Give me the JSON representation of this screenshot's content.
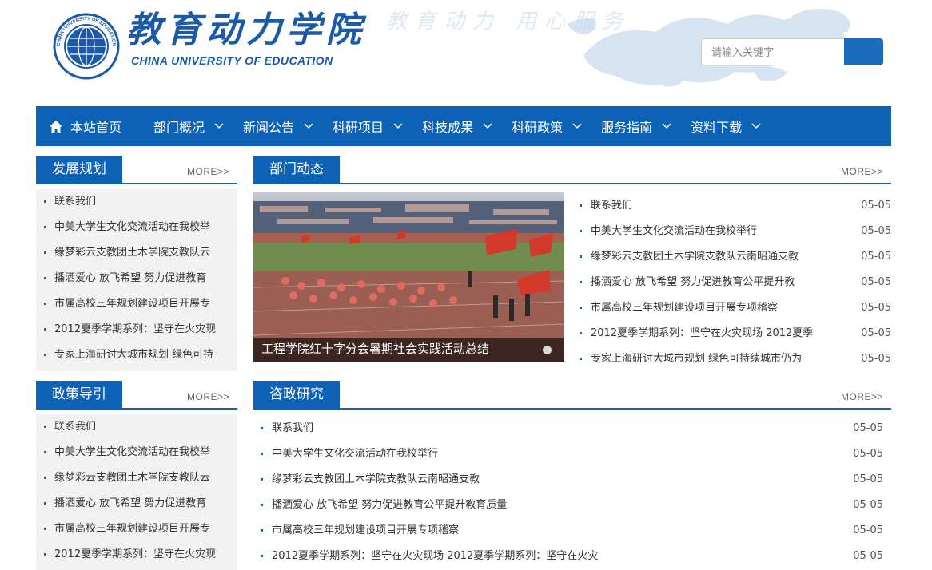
{
  "header": {
    "logo_title": "教育动力学院",
    "logo_subtitle": "CHINA UNIVERSITY OF EDUCATION",
    "logo_seal_text": "CHINA UNIVERSITY OF EDUCATION",
    "watermark": "教育动力 用心服务",
    "search": {
      "placeholder": "请输入关键字",
      "value": ""
    }
  },
  "nav": {
    "home": "本站首页",
    "items": [
      "部门概况",
      "新闻公告",
      "科研项目",
      "科技成果",
      "科研政策",
      "服务指南",
      "资料下载"
    ]
  },
  "more_label": "MORE>>",
  "panels": {
    "development": {
      "title": "发展规划",
      "items": [
        "联系我们",
        "中美大学生文化交流活动在我校举",
        "缘梦彩云支教团土木学院支教队云",
        "播洒爱心 放飞希望 努力促进教育",
        "市属高校三年规划建设项目开展专",
        "2012夏季学期系列：坚守在火灾现",
        "专家上海研讨大城市规划 绿色可持"
      ]
    },
    "policy": {
      "title": "政策导引",
      "items": [
        "联系我们",
        "中美大学生文化交流活动在我校举",
        "缘梦彩云支教团土木学院支教队云",
        "播洒爱心 放飞希望 努力促进教育",
        "市属高校三年规划建设项目开展专",
        "2012夏季学期系列：坚守在火灾现"
      ]
    },
    "dept_news": {
      "title": "部门动态",
      "photo_caption": "工程学院红十字分会暑期社会实践活动总结",
      "items": [
        {
          "text": "联系我们",
          "date": "05-05"
        },
        {
          "text": "中美大学生文化交流活动在我校举行",
          "date": "05-05"
        },
        {
          "text": "缘梦彩云支教团土木学院支教队云南昭通支教",
          "date": "05-05"
        },
        {
          "text": "播洒爱心 放飞希望 努力促进教育公平提升教",
          "date": "05-05"
        },
        {
          "text": "市属高校三年规划建设项目开展专项稽察",
          "date": "05-05"
        },
        {
          "text": "2012夏季学期系列：坚守在火灾现场 2012夏季",
          "date": "05-05"
        },
        {
          "text": "专家上海研讨大城市规划 绿色可持续城市仍为",
          "date": "05-05"
        }
      ]
    },
    "consult": {
      "title": "咨政研究",
      "items": [
        {
          "text": "联系我们",
          "date": "05-05"
        },
        {
          "text": "中美大学生文化交流活动在我校举行",
          "date": "05-05"
        },
        {
          "text": "缘梦彩云支教团土木学院支教队云南昭通支教",
          "date": "05-05"
        },
        {
          "text": "播洒爱心 放飞希望 努力促进教育公平提升教育质量",
          "date": "05-05"
        },
        {
          "text": "市属高校三年规划建设项目开展专项稽察",
          "date": "05-05"
        },
        {
          "text": "2012夏季学期系列：坚守在火灾现场 2012夏季学期系列：坚守在火灾",
          "date": "05-05"
        }
      ]
    }
  },
  "colors": {
    "primary": "#0d62b5",
    "side_bg": "#f2f2f2",
    "bullet": "#1c5ea8"
  },
  "icons": {
    "home": "home-icon",
    "chevron": "chevron-down-icon",
    "search": "search-button"
  }
}
